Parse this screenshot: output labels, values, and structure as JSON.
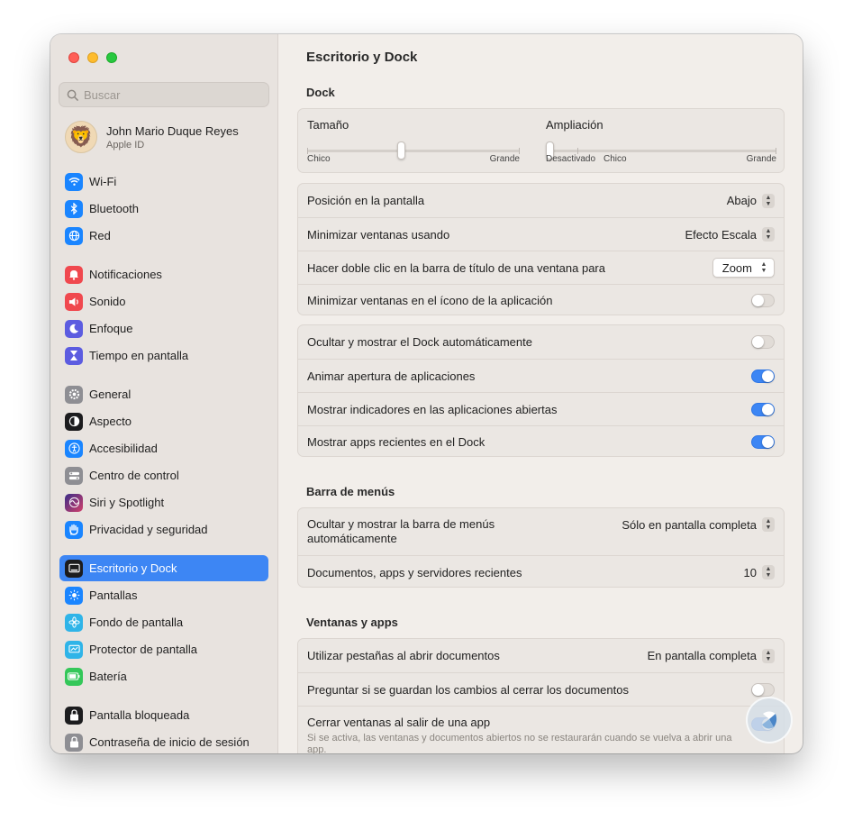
{
  "window": {
    "title": "Escritorio y Dock"
  },
  "search": {
    "placeholder": "Buscar"
  },
  "profile": {
    "name": "John Mario Duque Reyes",
    "subtitle": "Apple ID"
  },
  "sidebar": {
    "items": [
      {
        "label": "Wi-Fi",
        "icon": "wifi-icon",
        "color": "#1a85ff"
      },
      {
        "label": "Bluetooth",
        "icon": "bluetooth-icon",
        "color": "#1a85ff"
      },
      {
        "label": "Red",
        "icon": "globe-icon",
        "color": "#1a85ff"
      },
      {
        "label": "Notificaciones",
        "icon": "bell-icon",
        "color": "#f0484e"
      },
      {
        "label": "Sonido",
        "icon": "speaker-icon",
        "color": "#f0484e"
      },
      {
        "label": "Enfoque",
        "icon": "moon-icon",
        "color": "#5c5ce0"
      },
      {
        "label": "Tiempo en pantalla",
        "icon": "hourglass-icon",
        "color": "#5c5ce0"
      },
      {
        "label": "General",
        "icon": "gear-icon",
        "color": "#8e8e93"
      },
      {
        "label": "Aspecto",
        "icon": "appearance-icon",
        "color": "#1c1c1e"
      },
      {
        "label": "Accesibilidad",
        "icon": "accessibility-icon",
        "color": "#1a85ff"
      },
      {
        "label": "Centro de control",
        "icon": "control-center-icon",
        "color": "#8e8e93"
      },
      {
        "label": "Siri y Spotlight",
        "icon": "siri-icon",
        "color": "#a14bd9"
      },
      {
        "label": "Privacidad y seguridad",
        "icon": "hand-icon",
        "color": "#1a85ff"
      },
      {
        "label": "Escritorio y Dock",
        "icon": "dock-icon",
        "color": "#1c1c1e"
      },
      {
        "label": "Pantallas",
        "icon": "sun-icon",
        "color": "#1a85ff"
      },
      {
        "label": "Fondo de pantalla",
        "icon": "flower-icon",
        "color": "#2fb4e8"
      },
      {
        "label": "Protector de pantalla",
        "icon": "screensaver-icon",
        "color": "#2fb4e8"
      },
      {
        "label": "Batería",
        "icon": "battery-icon",
        "color": "#34c759"
      },
      {
        "label": "Pantalla bloqueada",
        "icon": "lock-icon",
        "color": "#1c1c1e"
      },
      {
        "label": "Contraseña de inicio de sesión",
        "icon": "lock-icon",
        "color": "#8e8e93"
      }
    ]
  },
  "main": {
    "dock_section": "Dock",
    "size_slider": {
      "label": "Tamaño",
      "min_label": "Chico",
      "max_label": "Grande",
      "value": 0.44
    },
    "magnify_slider": {
      "label": "Ampliación",
      "min_label": "Desactivado",
      "mid_label": "Chico",
      "max_label": "Grande",
      "value": 0.0
    },
    "position_row": {
      "label": "Posición en la pantalla",
      "value": "Abajo"
    },
    "minimize_row": {
      "label": "Minimizar ventanas usando",
      "value": "Efecto Escala"
    },
    "doubleclick_row": {
      "label": "Hacer doble clic en la barra de título de una ventana para",
      "value": "Zoom"
    },
    "minimize_icon_row": {
      "label": "Minimizar ventanas en el ícono de la aplicación",
      "on": false
    },
    "autohide_row": {
      "label": "Ocultar y mostrar el Dock automáticamente",
      "on": false
    },
    "animate_row": {
      "label": "Animar apertura de aplicaciones",
      "on": true
    },
    "indicators_row": {
      "label": "Mostrar indicadores en las aplicaciones abiertas",
      "on": true
    },
    "recent_row": {
      "label": "Mostrar apps recientes en el Dock",
      "on": true
    },
    "menubar_section": "Barra de menús",
    "menubar_autohide_row": {
      "label": "Ocultar y mostrar la barra de menús automáticamente",
      "value": "Sólo en pantalla completa"
    },
    "recent_docs_row": {
      "label": "Documentos, apps y servidores recientes",
      "value": "10"
    },
    "windows_section": "Ventanas y apps",
    "tabs_row": {
      "label": "Utilizar pestañas al abrir documentos",
      "value": "En pantalla completa"
    },
    "ask_save_row": {
      "label": "Preguntar si se guardan los cambios al cerrar los documentos",
      "on": false
    },
    "close_windows_row": {
      "label": "Cerrar ventanas al salir de una app",
      "description": "Si se activa, las ventanas y documentos abiertos no se restaurarán cuando se vuelva a abrir una app.",
      "on": true
    }
  }
}
